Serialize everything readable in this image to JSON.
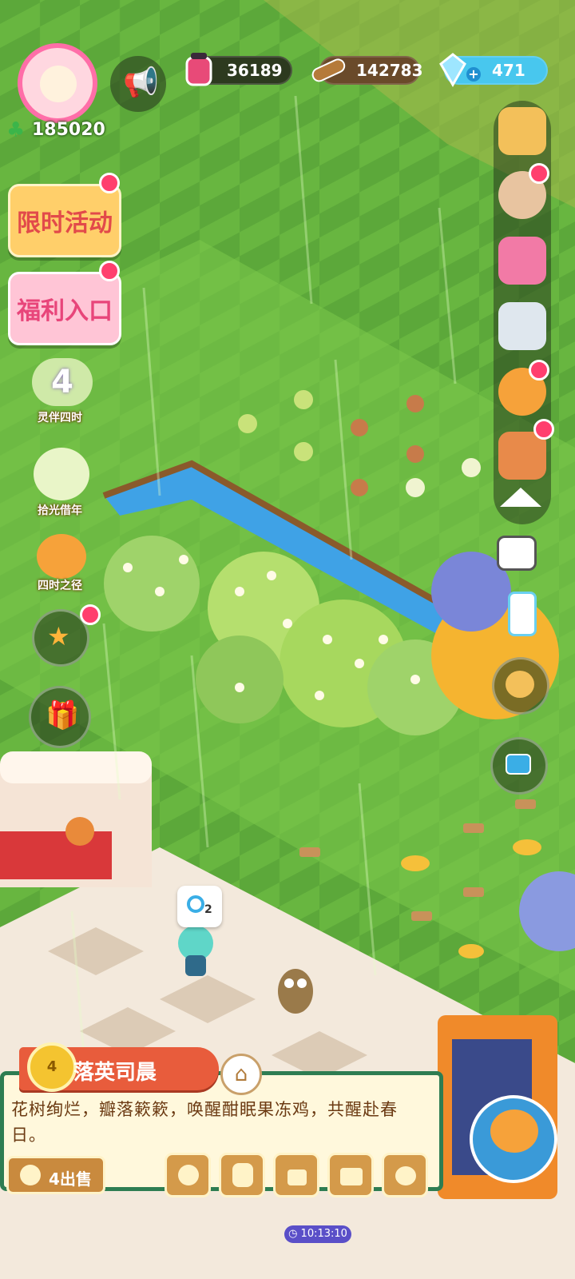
{
  "player": {
    "clover_count": "185020"
  },
  "resources": {
    "potion": "36189",
    "wood": "142783",
    "gems": "471"
  },
  "left_menu": {
    "limited_event": "限时活动",
    "welfare": "福利入口",
    "companion_four_seasons": "灵伴四时",
    "pick_light_year": "拾光借年",
    "four_seasons_path": "四时之径"
  },
  "task_bubble": {
    "count": "2"
  },
  "quest": {
    "level": "4",
    "title": "落英司晨",
    "description": "花树绚烂，瓣落簌簌，唤醒酣眠果冻鸡，共醒赴春日。",
    "sell_label": "4出售"
  },
  "clock": "10:13:10",
  "colors": {
    "grass": "#5fae3b",
    "panel_border": "#2e7d52",
    "banner": "#e85c3c",
    "badge": "#ff3f6e"
  }
}
